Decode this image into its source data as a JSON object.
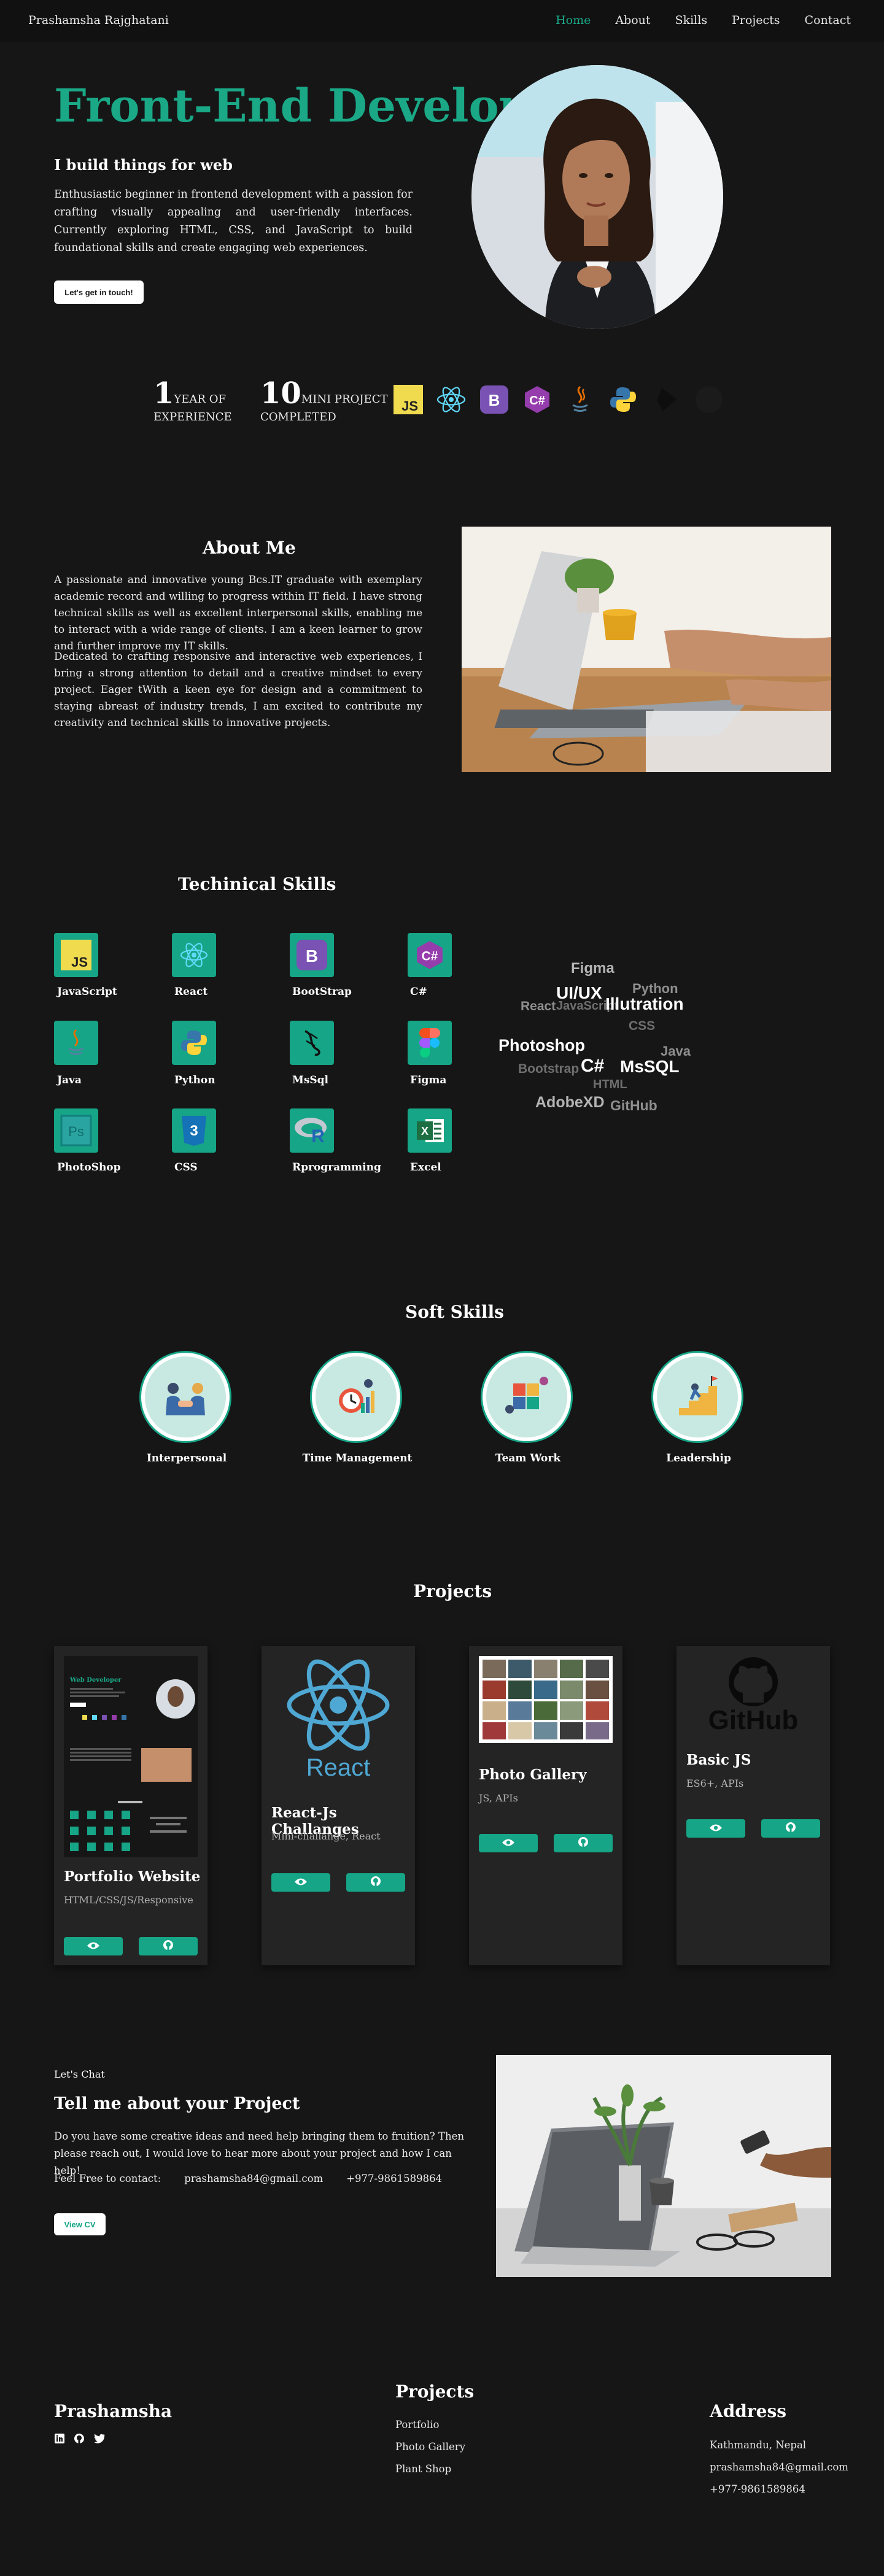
{
  "nav": {
    "brand": "Prashamsha Rajghatani",
    "links": [
      "Home",
      "About",
      "Skills",
      "Projects",
      "Contact"
    ]
  },
  "hero": {
    "title": "Front-End Developer",
    "subtitle": "I build things for web",
    "description": "Enthusiastic beginner in frontend development with a passion for crafting visually appealing and user-friendly interfaces. Currently exploring HTML, CSS, and JavaScript to build foundational skills and create engaging web experiences.",
    "cta": "Let's get in touch!"
  },
  "stats": [
    {
      "number": "1",
      "line1": "YEAR OF",
      "line2": "EXPERIENCE"
    },
    {
      "number": "10",
      "line1": "MINI PROJECT",
      "line2": "COMPLETED"
    }
  ],
  "tech_icons": [
    "javascript-icon",
    "react-icon",
    "bootstrap-icon",
    "csharp-icon",
    "java-icon",
    "python-icon",
    "figma-icon",
    "github-icon"
  ],
  "about": {
    "heading": "About Me",
    "p1": "A passionate and innovative young Bcs.IT graduate with exemplary academic record and willing to progress within IT field. I have strong technical skills as well as excellent interpersonal skills, enabling me to interact with a wide range of clients. I am a keen learner to grow and further improve my IT skills.",
    "p2": "Dedicated to crafting responsive and interactive web experiences, I bring a strong attention to detail and a creative mindset to every project. Eager tWith a keen eye for design and a commitment to staying abreast of industry trends, I am excited to contribute my creativity and technical skills to innovative projects."
  },
  "skills": {
    "heading": "Techinical Skills",
    "items": [
      "JavaScript",
      "React",
      "BootStrap",
      "C#",
      "Java",
      "Python",
      "MsSql",
      "Figma",
      "PhotoShop",
      "CSS",
      "Rprogramming",
      "Excel"
    ],
    "cloud": [
      "Figma",
      "Python",
      "UI/UX",
      "React",
      "JavaScript",
      "Illutration",
      "CSS",
      "Photoshop",
      "Java",
      "Bootstrap",
      "C#",
      "MsSQL",
      "HTML",
      "AdobeXD",
      "GitHub"
    ]
  },
  "soft_skills": {
    "heading": "Soft Skills",
    "items": [
      "Interpersonal",
      "Time Management",
      "Team Work",
      "Leadership"
    ]
  },
  "projects": {
    "heading": "Projects",
    "items": [
      {
        "title": "Portfolio Website",
        "meta": "HTML/CSS/JS/Responsive"
      },
      {
        "title": "React-Js Challanges",
        "meta": "Mini-challange, React"
      },
      {
        "title": "Photo Gallery",
        "meta": "JS, APIs"
      },
      {
        "title": "Basic JS",
        "meta": "ES6+, APIs"
      }
    ],
    "thumb_title": "Web Developer",
    "react_logo_text": "React",
    "github_logo_text": "GitHub"
  },
  "contact": {
    "lets_chat": "Let's Chat",
    "heading": "Tell me about your Project",
    "description": "Do you have some creative ideas and need help bringing them to fruition? Then please reach out, I would love to hear more about your project and how I can help!",
    "feel_free": "Feel Free to contact:",
    "email": "prashamsha84@gmail.com",
    "phone": "+977-9861589864",
    "cv_button": "View CV"
  },
  "footer": {
    "brand": "Prashamsha",
    "projects_heading": "Projects",
    "projects_links": [
      "Portfolio",
      "Photo Gallery",
      "Plant Shop"
    ],
    "address_heading": "Address",
    "address_lines": [
      "Kathmandu, Nepal",
      "prashamsha84@gmail.com",
      "+977-9861589864"
    ]
  },
  "colors": {
    "accent": "#1aa886",
    "background": "#161616",
    "card": "#242424"
  }
}
